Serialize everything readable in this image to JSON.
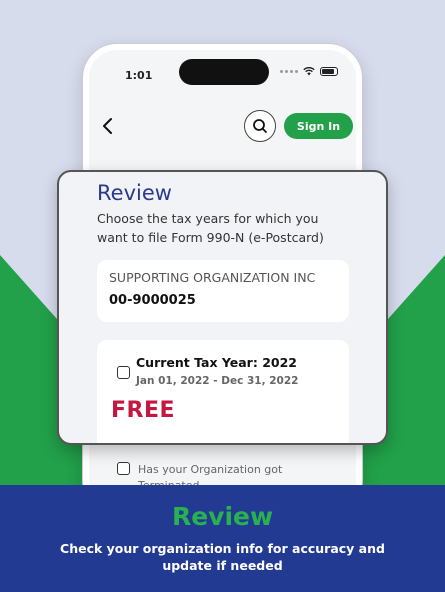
{
  "status_bar": {
    "time": "1:01"
  },
  "header": {
    "sign_in_label": "Sign In"
  },
  "review": {
    "title": "Review",
    "subtitle": "Choose the tax years for which you want to file Form 990-N (e-Postcard)"
  },
  "organization": {
    "name": "SUPPORTING ORGANIZATION INC",
    "ein": "00-9000025"
  },
  "tax_year": {
    "title": "Current Tax Year: 2022",
    "dates": "Jan 01, 2022 - Dec 31, 2022",
    "price": "FREE",
    "checked": false
  },
  "terminated": {
    "label": "Has your Organization got Terminated",
    "checked": false
  },
  "banner": {
    "title": "Review",
    "text": "Check your organization info for accuracy and update if needed"
  },
  "colors": {
    "brand_green": "#22a04a",
    "brand_blue": "#233a93",
    "title_blue": "#2a3a8c",
    "free_red": "#c4163f"
  }
}
